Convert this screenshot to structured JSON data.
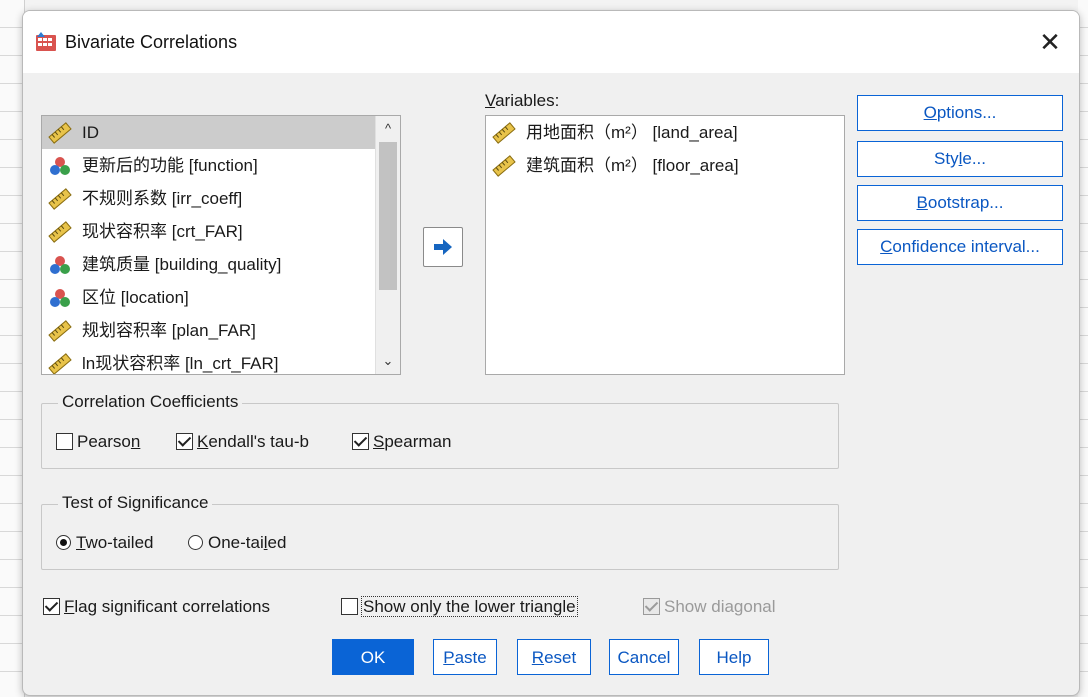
{
  "window": {
    "title": "Bivariate Correlations",
    "close_glyph": "✕"
  },
  "source_list": {
    "items": [
      {
        "label": "ID",
        "icon": "scale-ruler-icon",
        "selected": true
      },
      {
        "label": "更新后的功能 [function]",
        "icon": "nominal-balls-icon"
      },
      {
        "label": "不规则系数 [irr_coeff]",
        "icon": "scale-ruler-icon"
      },
      {
        "label": "现状容积率 [crt_FAR]",
        "icon": "scale-ruler-icon"
      },
      {
        "label": "建筑质量 [building_quality]",
        "icon": "nominal-balls-icon"
      },
      {
        "label": "区位 [location]",
        "icon": "nominal-balls-icon"
      },
      {
        "label": "规划容积率 [plan_FAR]",
        "icon": "scale-ruler-icon"
      },
      {
        "label": "ln现状容积率 [ln_crt_FAR]",
        "icon": "scale-ruler-icon"
      }
    ]
  },
  "variables": {
    "label_u": "V",
    "label_rest": "ariables:",
    "items": [
      {
        "label": "用地面积（m²） [land_area]",
        "icon": "scale-ruler-icon"
      },
      {
        "label": "建筑面积（m²） [floor_area]",
        "icon": "scale-ruler-icon"
      }
    ]
  },
  "side_buttons": {
    "options": {
      "u": "O",
      "rest": "ptions..."
    },
    "style": {
      "pre": "Sty",
      "u": "l",
      "rest": "e..."
    },
    "bootstrap": {
      "u": "B",
      "rest": "ootstrap..."
    },
    "confidence": {
      "u": "C",
      "rest": "onfidence interval..."
    }
  },
  "coefficients": {
    "title": "Correlation Coefficients",
    "pearson": {
      "pre": "Pearso",
      "u": "n",
      "checked": false
    },
    "kendall": {
      "u": "K",
      "rest": "endall's tau-b",
      "checked": true
    },
    "spearman": {
      "u": "S",
      "rest": "pearman",
      "checked": true
    }
  },
  "significance": {
    "title": "Test of Significance",
    "two_tailed": {
      "u": "T",
      "rest": "wo-tailed",
      "checked": true
    },
    "one_tailed": {
      "pre": "One-tai",
      "u": "l",
      "rest": "ed",
      "checked": false
    }
  },
  "options": {
    "flag": {
      "u": "F",
      "rest": "lag significant correlations",
      "checked": true
    },
    "lower": {
      "label": "Show only the lower triangle",
      "checked": false
    },
    "diagonal": {
      "label": "Show diagonal",
      "checked": true,
      "disabled": true
    }
  },
  "buttons": {
    "ok": "OK",
    "paste": {
      "u": "P",
      "rest": "aste"
    },
    "reset": {
      "u": "R",
      "rest": "eset"
    },
    "cancel": "Cancel",
    "help": "Help"
  },
  "colors": {
    "accent": "#0a64d6",
    "selected_bg": "#cccccc",
    "dialog_bg": "#f0f0f0"
  }
}
